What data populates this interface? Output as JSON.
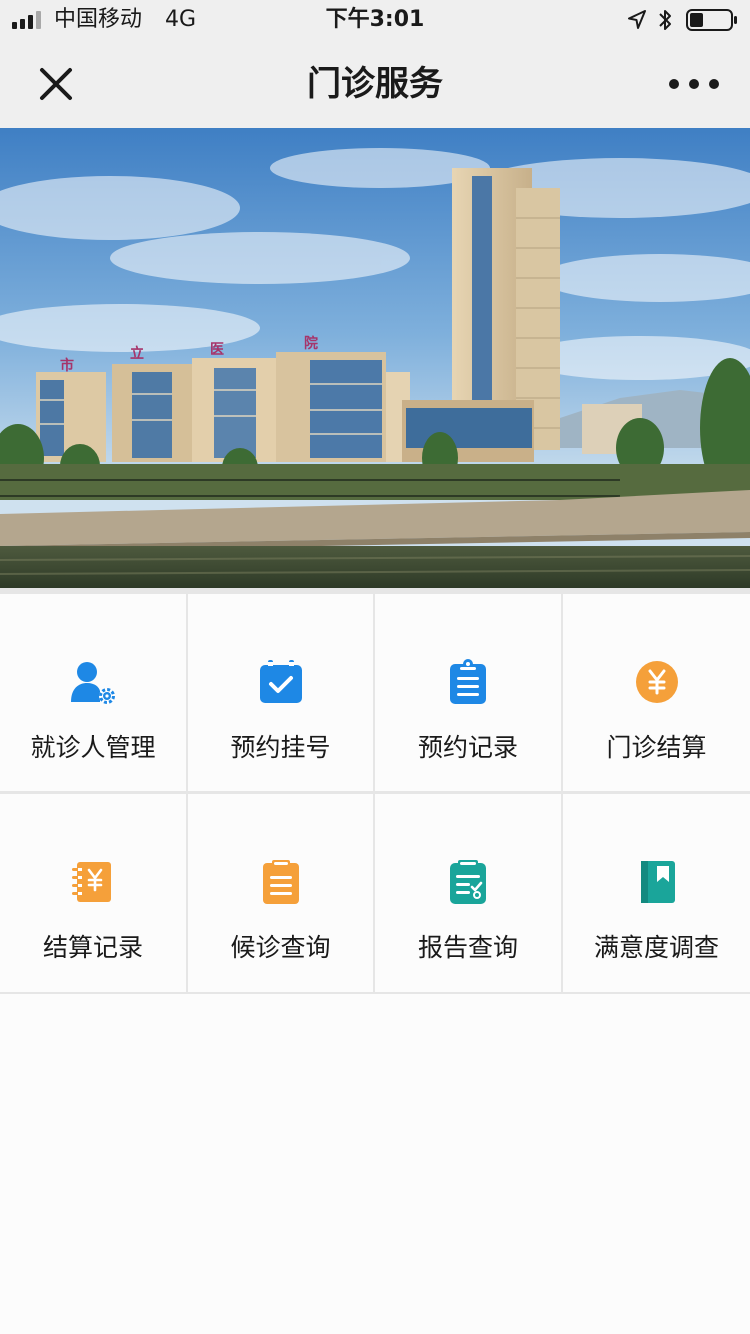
{
  "status_bar": {
    "carrier": "中国移动",
    "network": "4G",
    "time": "下午3:01"
  },
  "nav": {
    "title": "门诊服务"
  },
  "banner": {
    "building_sign": [
      "市",
      "立",
      "医",
      "院"
    ]
  },
  "services": [
    {
      "label": "就诊人管理",
      "icon": "patient-settings-icon",
      "color": "#1e88e5"
    },
    {
      "label": "预约挂号",
      "icon": "calendar-check-icon",
      "color": "#1e88e5"
    },
    {
      "label": "预约记录",
      "icon": "clipboard-list-icon",
      "color": "#1e88e5"
    },
    {
      "label": "门诊结算",
      "icon": "yuan-coin-icon",
      "color": "#f5a03a"
    },
    {
      "label": "结算记录",
      "icon": "yuan-notebook-icon",
      "color": "#f5a03a"
    },
    {
      "label": "候诊查询",
      "icon": "clipboard-queue-icon",
      "color": "#f5a03a"
    },
    {
      "label": "报告查询",
      "icon": "report-check-icon",
      "color": "#1aa59a"
    },
    {
      "label": "满意度调查",
      "icon": "survey-book-icon",
      "color": "#1aa59a"
    }
  ]
}
